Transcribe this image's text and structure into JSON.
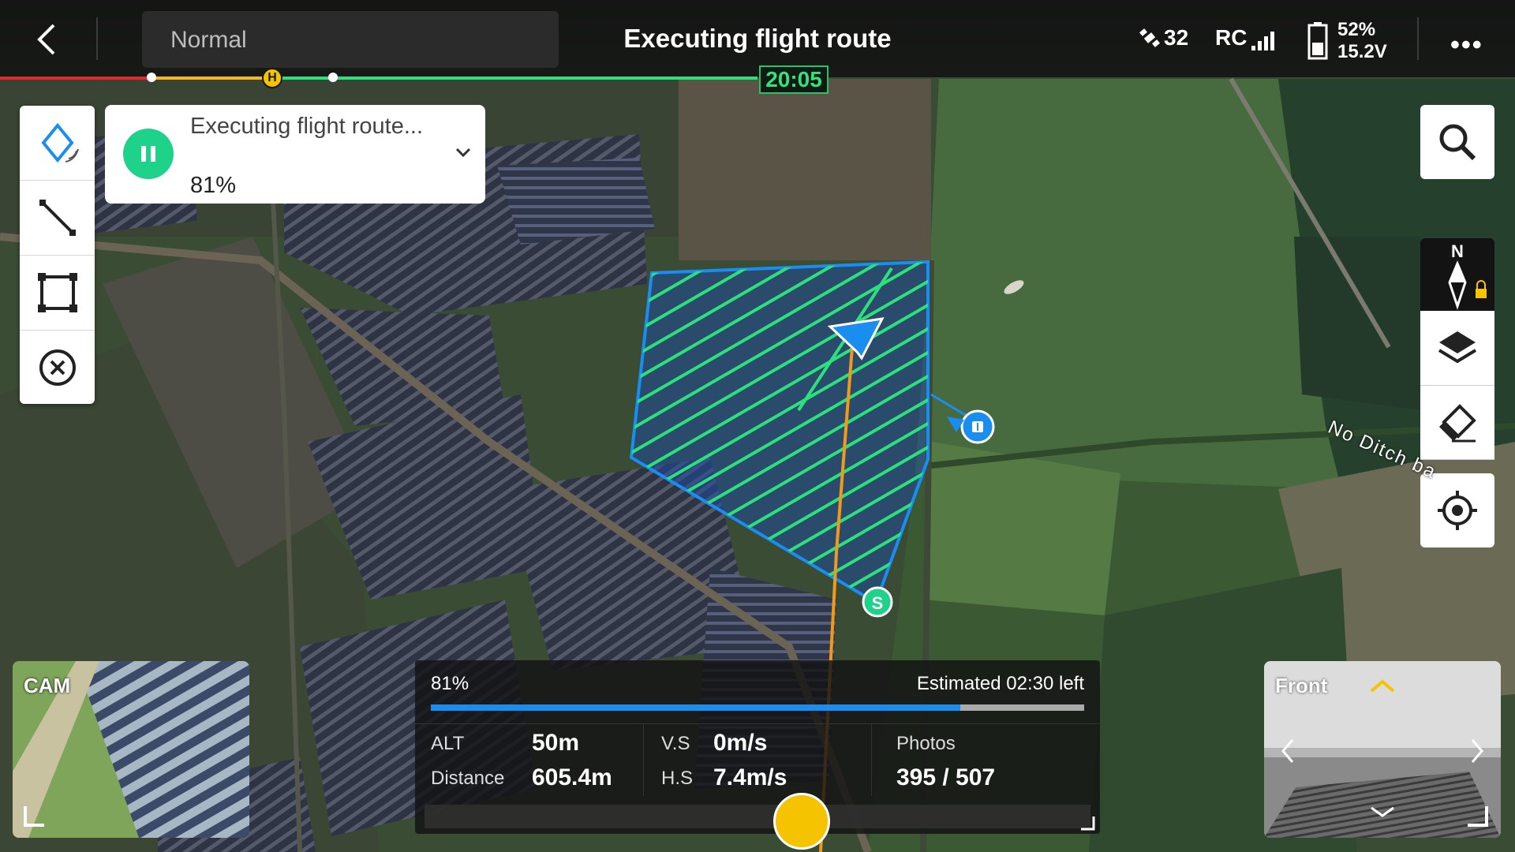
{
  "header": {
    "back_icon": "back-arrow-icon",
    "flight_mode": "Normal",
    "title": "Executing flight route",
    "satellites": "32",
    "rc_label": "RC",
    "battery_percent": "52%",
    "battery_voltage": "15.2V",
    "more_icon": "more-icon"
  },
  "timeline": {
    "time": "20:05",
    "home_marker": "H"
  },
  "left_toolbar": {
    "items": [
      {
        "name": "waypoint-tool",
        "icon": "diamond-waypoint-icon"
      },
      {
        "name": "line-tool",
        "icon": "line-segment-icon"
      },
      {
        "name": "area-tool",
        "icon": "area-square-icon"
      },
      {
        "name": "cancel-tool",
        "icon": "close-circle-icon"
      }
    ]
  },
  "task": {
    "status": "Executing flight route...",
    "progress": "81%",
    "progress_value": 0.81
  },
  "right_toolbar": {
    "compass_label": "N",
    "items": [
      "search-icon",
      "compass-lock-icon",
      "layers-icon",
      "eraser-icon",
      "locate-icon"
    ]
  },
  "map": {
    "road_label": "No Ditch ba",
    "start_marker": "S"
  },
  "camera": {
    "label": "CAM"
  },
  "front_view": {
    "label": "Front"
  },
  "telemetry": {
    "progress_text": "81%",
    "estimated": "Estimated 02:30 left",
    "alt_label": "ALT",
    "alt_value": "50m",
    "distance_label": "Distance",
    "distance_value": "605.4m",
    "vs_label": "V.S",
    "vs_value": "0m/s",
    "hs_label": "H.S",
    "hs_value": "7.4m/s",
    "photos_label": "Photos",
    "photos_value": "395 / 507"
  },
  "colors": {
    "accent_green": "#1fd28a",
    "route_green": "#2ce07e",
    "route_blue": "#1a8ef0",
    "timeline_yellow": "#f6b91c",
    "timeline_red": "#e0282e"
  }
}
